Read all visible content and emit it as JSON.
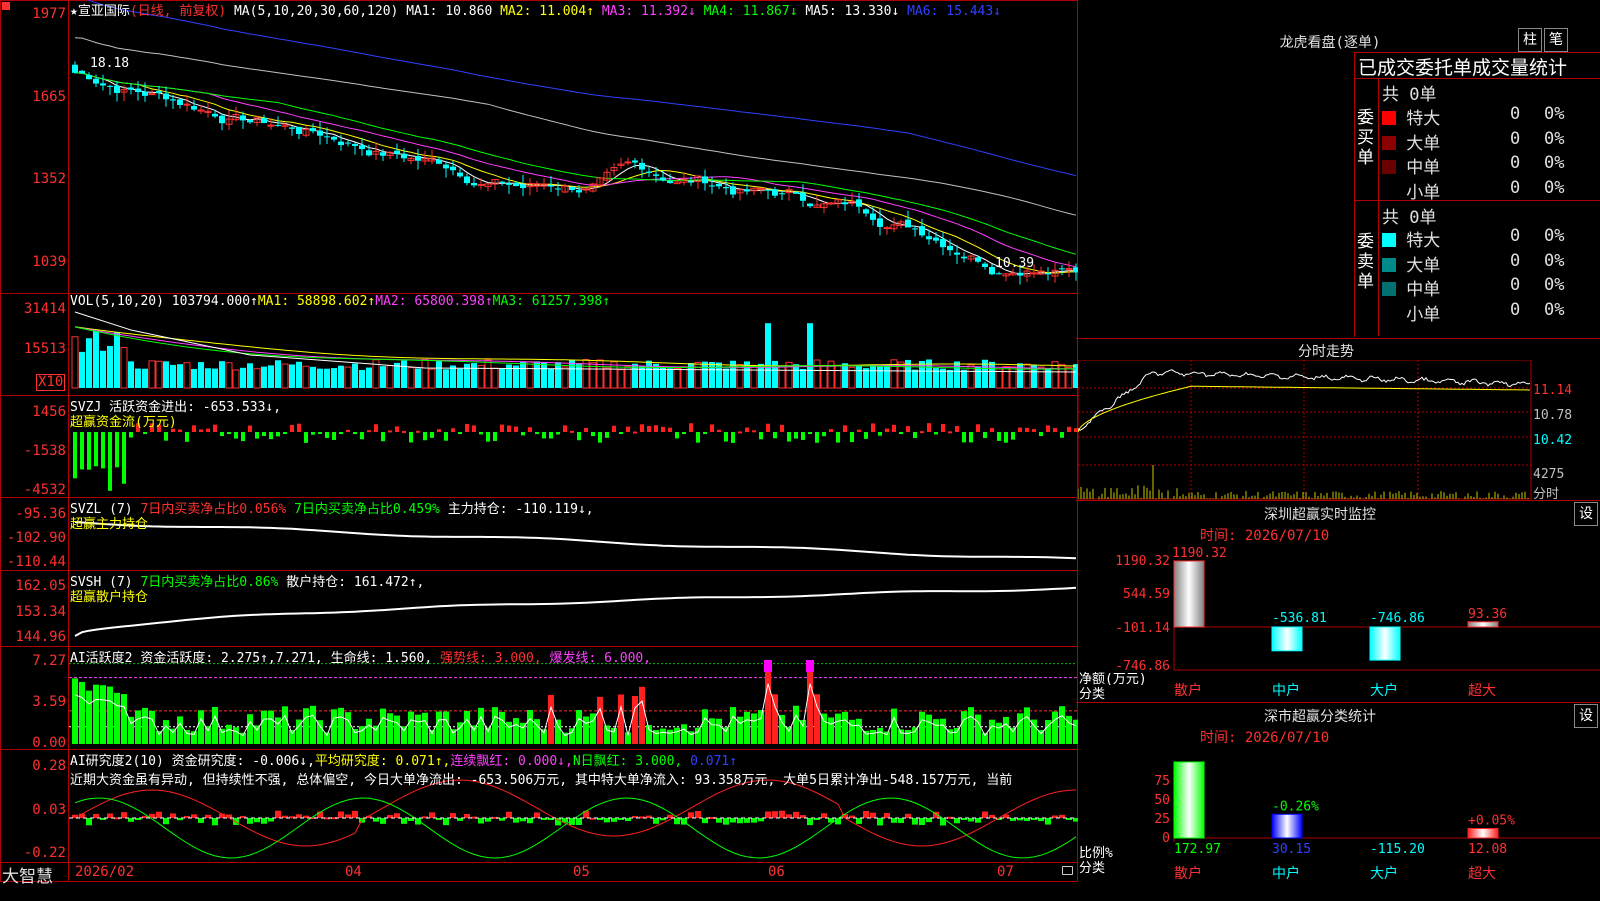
{
  "app_logo": "大智慧",
  "stock": {
    "star": "★",
    "name": "宣亚国际",
    "period": "(日线, 前复权)"
  },
  "kline": {
    "header": {
      "ma_def": "MA(5,10,20,30,60,120)",
      "ma1": "MA1: 10.860",
      "ma2": "MA2: 11.004↑",
      "ma3": "MA3: 11.392↓",
      "ma4": "MA4: 11.867↓",
      "ma5": "MA5: 13.330↓",
      "ma6": "MA6: 15.443↓"
    },
    "y_labels": [
      "1977",
      "1665",
      "1352",
      "1039"
    ],
    "high_label": "18.18",
    "low_label": "10.39"
  },
  "vol": {
    "header": {
      "def": "VOL(5,10,20)",
      "v": "103794.000↑",
      "ma1": "MA1: 58898.602↑",
      "ma2": "MA2: 65800.398↑",
      "ma3": "MA3: 61257.398↑"
    },
    "y_labels": [
      "31414",
      "15513"
    ],
    "unit": "X10"
  },
  "svzj": {
    "header": {
      "def": "SVZJ",
      "label": "活跃资金进出: -653.533↓,",
      "sub": "超赢资金流(万元)"
    },
    "y_labels": [
      "1456",
      "-1538",
      "-4532"
    ]
  },
  "svzl": {
    "header": {
      "def": "SVZL (7)",
      "a": "7日内买卖净占比0.056%",
      "b": "7日内买卖净占比0.459%",
      "c": "主力持仓: -110.119↓,",
      "sub": "超赢主力持仓"
    },
    "y_labels": [
      "-95.36",
      "-102.90",
      "-110.44"
    ]
  },
  "svsh": {
    "header": {
      "def": "SVSH (7)",
      "a": "7日内买卖净占比0.86%",
      "b": "散户持仓: 161.472↑,",
      "sub": "超赢散户持仓"
    },
    "y_labels": [
      "162.05",
      "153.34",
      "144.96"
    ]
  },
  "ai_active": {
    "header": {
      "def": "AI活跃度2",
      "a": "资金活跃度: 2.275↑,",
      "b": "7.271,",
      "c": "生命线: 1.560,",
      "d": "强势线: 3.000,",
      "e": "爆发线: 6.000,"
    },
    "y_labels": [
      "7.27",
      "3.59",
      "0.00"
    ]
  },
  "ai_research": {
    "header": {
      "def": "AI研究度2(10)",
      "a": "资金研究度: -0.006↓,",
      "b": "平均研究度: 0.071↑,",
      "c": "连续飘红: 0.000↓,",
      "d": "N日飘红: 3.000,",
      "e": "0.071↑"
    },
    "comment": "近期大资金虽有异动, 但持续性不强, 总体偏空, 今日大单净流出: -653.506万元, 其中特大单净流入: 93.358万元, 大单5日累计净出-548.157万元, 当前",
    "y_labels": [
      "0.28",
      "0.03",
      "-0.22"
    ]
  },
  "x_axis": [
    "2026/02",
    "04",
    "05",
    "06",
    "07"
  ],
  "right": {
    "lhb": {
      "title": "龙虎看盘(逐单)",
      "btn1": "柱",
      "btn2": "笔",
      "subtitle": "已成交委托单成交量统计",
      "buy_side": "委买单",
      "sell_side": "委卖单",
      "buy_total": "共 0单",
      "sell_total": "共 0单",
      "rows": [
        {
          "label": "特大",
          "count": "0",
          "pct": "0%"
        },
        {
          "label": "大单",
          "count": "0",
          "pct": "0%"
        },
        {
          "label": "中单",
          "count": "0",
          "pct": "0%"
        },
        {
          "label": "小单",
          "count": "0",
          "pct": "0%"
        }
      ],
      "buy_colors": [
        "#ff0000",
        "#8b0000",
        "#6b0000",
        "#000000"
      ],
      "sell_colors": [
        "#00ffff",
        "#008b8b",
        "#007070",
        "#000000"
      ]
    },
    "fenshi": {
      "title": "分时走势",
      "y_labels": [
        "11.14",
        "10.78",
        "10.42"
      ],
      "vol_label": "4275",
      "unit": "分时"
    },
    "monitor": {
      "title": "深圳超赢实时监控",
      "btn": "设",
      "time": "时间: 2026/07/10",
      "y_labels": [
        "1190.32",
        "544.59",
        "-101.14",
        "-746.86"
      ],
      "unit_a": "净额(万元)",
      "unit_b": "分类",
      "bars": [
        {
          "name": "散户",
          "value": 1190.32,
          "label": "1190.32"
        },
        {
          "name": "中户",
          "value": -536.81,
          "label": "-536.81"
        },
        {
          "name": "大户",
          "value": -746.86,
          "label": "-746.86"
        },
        {
          "name": "超大",
          "value": 93.36,
          "label": "93.36"
        }
      ]
    },
    "classify": {
      "title": "深市超赢分类统计",
      "btn": "设",
      "time": "时间: 2026/07/10",
      "y_labels": [
        "75",
        "50",
        "25",
        "0"
      ],
      "unit_a": "比例%",
      "unit_b": "分类",
      "bars": [
        {
          "name": "散户",
          "pct": 80,
          "value": "172.97",
          "top": ""
        },
        {
          "name": "中户",
          "pct": 25,
          "value": "30.15",
          "top": "-0.26%"
        },
        {
          "name": "大户",
          "pct": 0,
          "value": "-115.20",
          "top": ""
        },
        {
          "name": "超大",
          "pct": 10,
          "value": "12.08",
          "top": "+0.05%"
        }
      ]
    }
  }
}
